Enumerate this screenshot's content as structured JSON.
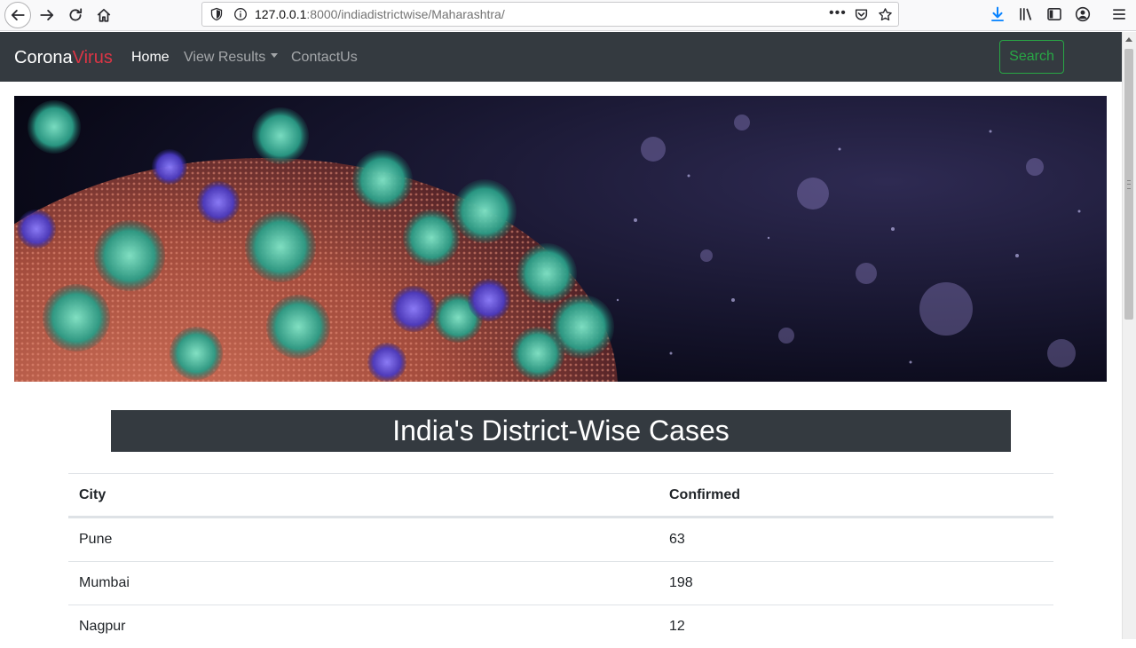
{
  "browser": {
    "url_host": "127.0.0.1",
    "url_rest": ":8000/indiadistrictwise/Maharashtra/",
    "menu_dots": "•••"
  },
  "navbar": {
    "brand_part1": "Corona",
    "brand_part2": "Virus",
    "links": [
      {
        "label": "Home"
      },
      {
        "label": "View Results"
      },
      {
        "label": "ContactUs"
      }
    ],
    "search_label": "Search",
    "colors": {
      "bg": "#343a40",
      "brand_accent": "#dc3545",
      "search": "#28a745"
    }
  },
  "main": {
    "heading": "India's District-Wise Cases",
    "table": {
      "headers": [
        "City",
        "Confirmed"
      ],
      "rows": [
        [
          "Pune",
          "63"
        ],
        [
          "Mumbai",
          "198"
        ],
        [
          "Nagpur",
          "12"
        ]
      ]
    }
  }
}
